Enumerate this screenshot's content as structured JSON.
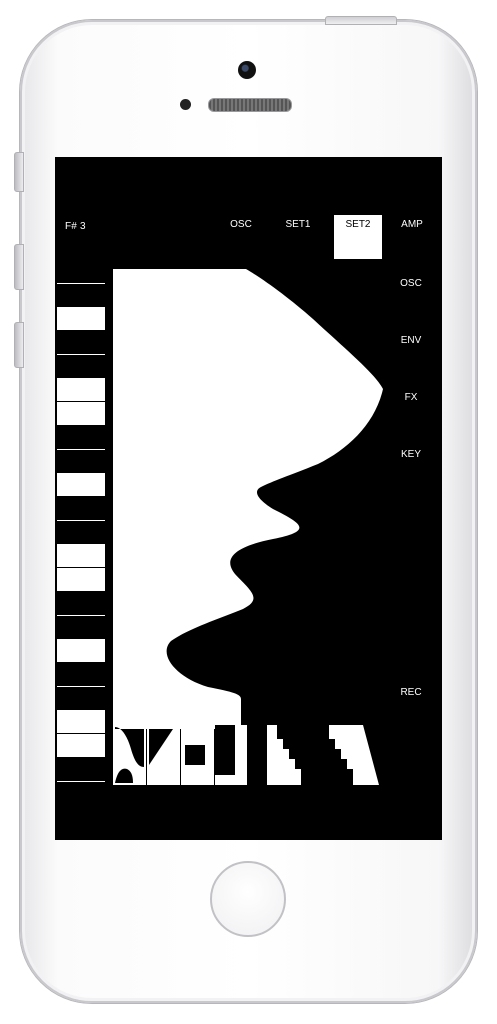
{
  "note": {
    "label": "F# 3"
  },
  "tabs": [
    {
      "label": "OSC",
      "active": false
    },
    {
      "label": "SET1",
      "active": false
    },
    {
      "label": "SET2",
      "active": true
    },
    {
      "label": "AMP",
      "active": false
    }
  ],
  "side_menu": [
    {
      "label": "OSC"
    },
    {
      "label": "ENV"
    },
    {
      "label": "FX"
    },
    {
      "label": "KEY"
    },
    {
      "label": "REC"
    }
  ],
  "colors": {
    "screen_bg": "#000000",
    "foreground": "#ffffff"
  }
}
